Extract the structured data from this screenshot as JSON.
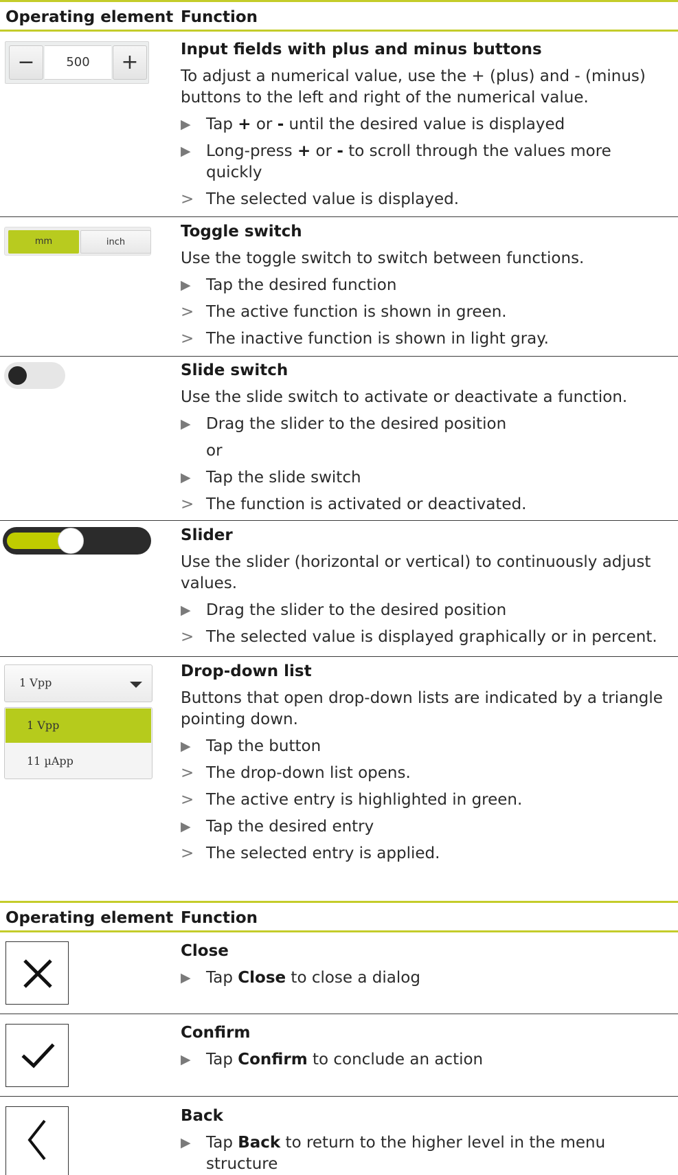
{
  "table1": {
    "header": {
      "col1": "Operating element",
      "col2": "Function"
    },
    "rows": [
      {
        "title": "Input fields with plus and minus buttons",
        "intro": "To adjust a numerical value, use the + (plus) and - (minus) buttons to the left and right of the numerical value.",
        "step1_a": "Tap ",
        "step1_plus": "+",
        "step1_b": " or ",
        "step1_minus": "-",
        "step1_c": " until the desired value is displayed",
        "step2_a": "Long-press ",
        "step2_plus": "+",
        "step2_b": " or ",
        "step2_minus": "-",
        "step2_c": " to scroll through the values more quickly",
        "result1": "The selected value is displayed.",
        "element": {
          "minus_label": "−",
          "value": "500",
          "plus_label": "+"
        }
      },
      {
        "title": "Toggle switch",
        "intro": "Use the toggle switch to switch between functions.",
        "step1": "Tap the desired function",
        "result1": "The active function is shown in green.",
        "result2": "The inactive function is shown in light gray.",
        "element": {
          "option_active": "mm",
          "option_inactive": "inch"
        }
      },
      {
        "title": "Slide switch",
        "intro": "Use the slide switch to activate or deactivate a function.",
        "step1": "Drag the slider to the desired position",
        "or": "or",
        "step2": "Tap the slide switch",
        "result1": "The function is activated or deactivated.",
        "element": {
          "state": "off"
        }
      },
      {
        "title": "Slider",
        "intro": "Use the slider (horizontal or vertical) to continuously adjust values.",
        "step1": "Drag the slider to the desired position",
        "result1": "The selected value is displayed graphically or in percent.",
        "element": {
          "level": 0.45,
          "fill_color": "#c0cc00"
        }
      },
      {
        "title": "Drop-down list",
        "intro": "Buttons that open drop-down lists are indicated by a triangle pointing down.",
        "step1": "Tap the button",
        "result1": "The drop-down list opens.",
        "result2": "The active entry is highlighted in green.",
        "step2": "Tap the desired entry",
        "result3": "The selected entry is applied.",
        "element": {
          "selected": "1 Vpp",
          "options": [
            "1 Vpp",
            "11 µApp"
          ]
        }
      }
    ]
  },
  "table2": {
    "header": {
      "col1": "Operating element",
      "col2": "Function"
    },
    "rows": [
      {
        "title": "Close",
        "step_a": "Tap ",
        "step_bold": "Close",
        "step_b": " to close a dialog",
        "icon": "close-icon"
      },
      {
        "title": "Confirm",
        "step_a": "Tap ",
        "step_bold": "Confirm",
        "step_b": " to conclude an action",
        "icon": "check-icon"
      },
      {
        "title": "Back",
        "step_a": "Tap ",
        "step_bold": "Back",
        "step_b": " to return to the higher level in the menu structure",
        "icon": "chevron-left-icon"
      }
    ]
  },
  "markers": {
    "step": "▶",
    "result": ">"
  },
  "colors": {
    "accent_line": "#c4cc2a",
    "active_green": "#b8cb1f"
  }
}
